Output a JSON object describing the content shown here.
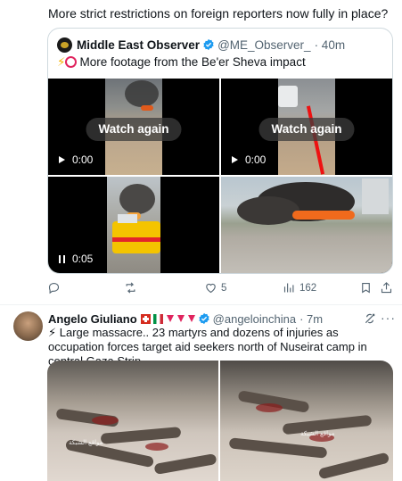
{
  "tweet1": {
    "text": "More strict restrictions on foreign reporters now fully in place?",
    "quote": {
      "author_name": "Middle East Observer",
      "author_handle": "@ME_Observer_",
      "time": "· 40m",
      "text": "More footage from the Be'er Sheva impact",
      "media": [
        {
          "overlay": "Watch again",
          "time": "0:00",
          "state": "play"
        },
        {
          "overlay": "Watch again",
          "time": "0:00",
          "state": "play"
        },
        {
          "time": "0:05",
          "state": "pause"
        },
        {
          "type": "photo"
        }
      ]
    },
    "actions": {
      "reply": "",
      "repost": "",
      "like": "5",
      "views": "162"
    }
  },
  "tweet2": {
    "author_name": "Angelo Giuliano",
    "author_handle": "@angeloinchina",
    "time": "· 7m",
    "text": "⚡ Large massacre.. 23 martyrs and dozens of injuries as occupation forces target aid seekers north of Nuseirat camp in central Gaza Strip"
  },
  "colors": {
    "verified": "#1d9bf0",
    "secondary_text": "#536471",
    "border": "#cfd9de"
  },
  "icons": [
    "verified-badge-icon",
    "lightning-icon",
    "red-circle-icon",
    "play-icon",
    "pause-icon",
    "reply-icon",
    "repost-icon",
    "like-icon",
    "views-icon",
    "bookmark-icon",
    "share-icon",
    "grok-icon",
    "more-icon",
    "swiss-flag-icon",
    "italy-flag-icon",
    "red-triangle-icon"
  ]
}
